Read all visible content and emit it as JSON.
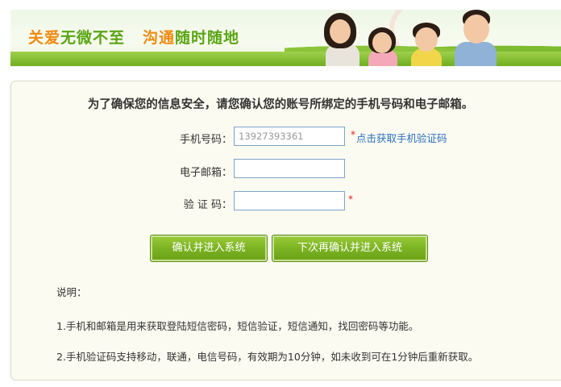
{
  "banner": {
    "slogan_part1_orange": "关爱",
    "slogan_part1_green": "无微不至",
    "slogan_part2_orange": "沟通",
    "slogan_part2_green": "随时随地"
  },
  "form": {
    "title": "为了确保您的信息安全，请您确认您的账号所绑定的手机号码和电子邮箱。",
    "phone_label": "手机号码：",
    "phone_value": "13927393361",
    "phone_required": "*",
    "get_code_link": "点击获取手机验证码",
    "email_label": "电子邮箱：",
    "email_value": "",
    "code_label": "验 证 码：",
    "code_value": "",
    "code_required": "*",
    "confirm_button": "确认并进入系统",
    "later_button": "下次再确认并进入系统"
  },
  "notes": {
    "heading": "说明：",
    "items": [
      "1.手机和邮箱是用来获取登陆短信密码，短信验证，短信通知，找回密码等功能。",
      "2.手机验证码支持移动，联通，电信号码，有效期为10分钟，如未收到可在1分钟后重新获取。"
    ]
  },
  "colors": {
    "accent_orange": "#f08a12",
    "accent_green": "#5aa512",
    "button_green": "#7cb322",
    "link_blue": "#2a6fc0",
    "required_red": "#e02020"
  }
}
